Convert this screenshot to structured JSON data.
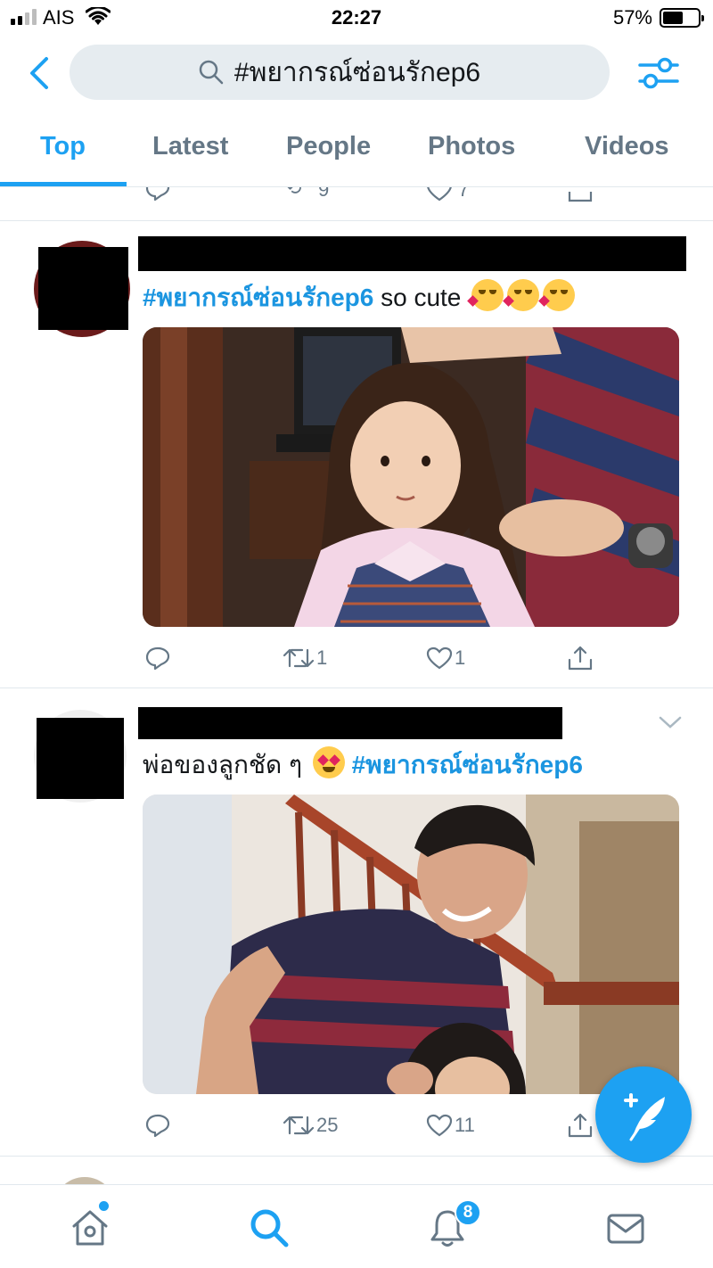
{
  "status_bar": {
    "carrier": "AIS",
    "time": "22:27",
    "battery_percent": "57%",
    "battery_level": 0.57,
    "signal_bars": 2
  },
  "search": {
    "query": "#พยากรณ์ซ่อนรักep6"
  },
  "tabs": [
    {
      "label": "Top",
      "active": true
    },
    {
      "label": "Latest",
      "active": false
    },
    {
      "label": "People",
      "active": false
    },
    {
      "label": "Photos",
      "active": false
    },
    {
      "label": "Videos",
      "active": false
    }
  ],
  "feed": {
    "partial_tweet": {
      "retweets": "9",
      "likes": "7"
    },
    "tweets": [
      {
        "hashtag": "#พยากรณ์ซ่อนรักep6",
        "text": " so cute ",
        "emojis": [
          "smiling-face-with-hearts",
          "smiling-face-with-hearts",
          "smiling-face-with-hearts"
        ],
        "replies": "",
        "retweets": "1",
        "likes": "1"
      },
      {
        "text": "พ่อของลูกชัด ๆ ",
        "emojis": [
          "heart-eyes"
        ],
        "hashtag": "#พยากรณ์ซ่อนรักep6",
        "replies": "",
        "retweets": "25",
        "likes": "11"
      }
    ]
  },
  "bottom_nav": {
    "items": [
      "home-icon",
      "search-icon",
      "notifications-icon",
      "messages-icon"
    ],
    "notification_count": "8"
  },
  "colors": {
    "accent": "#1da1f2",
    "hashtag": "#1b95e0",
    "muted": "#657786",
    "search_bg": "#e6ecf0"
  }
}
